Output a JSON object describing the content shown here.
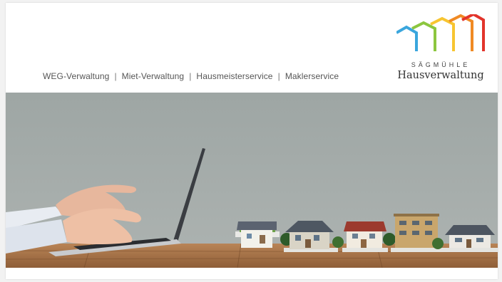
{
  "nav": {
    "items": [
      "WEG-Verwaltung",
      "Miet-Verwaltung",
      "Hausmeisterservice",
      "Maklerservice"
    ],
    "separator": "|"
  },
  "logo": {
    "sub": "SÄGMÜHLE",
    "main": "Hausverwaltung",
    "colors": [
      "#3aa6dd",
      "#8cc63f",
      "#f7c531",
      "#f08a24",
      "#e2342b"
    ]
  },
  "hero": {
    "backdrop_color": "#a7aeac",
    "table_color": "#b07a4c"
  }
}
